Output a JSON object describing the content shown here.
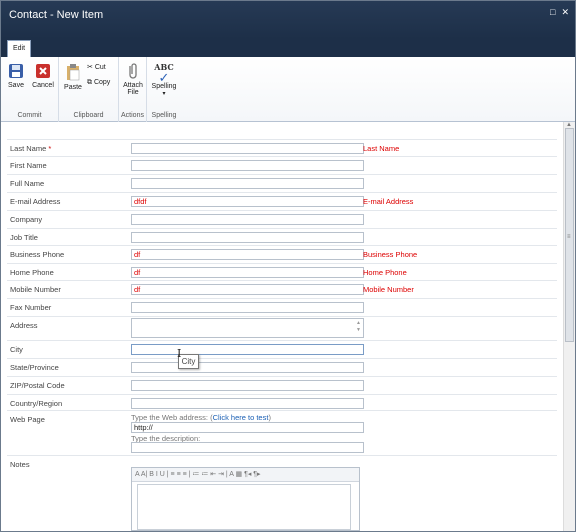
{
  "window": {
    "title": "Contact - New Item"
  },
  "ribbon": {
    "tab": "Edit",
    "groups": [
      {
        "name": "Commit",
        "buttons": [
          "Save",
          "Cancel"
        ]
      },
      {
        "name": "Clipboard",
        "buttons": [
          "Paste",
          "Cut",
          "Copy"
        ]
      },
      {
        "name": "Actions",
        "buttons": [
          "Attach\nFile"
        ]
      },
      {
        "name": "Spelling",
        "buttons": [
          "Spelling"
        ]
      }
    ],
    "save": "Save",
    "cancel": "Cancel",
    "paste": "Paste",
    "cut": "Cut",
    "copy": "Copy",
    "attach1": "Attach",
    "attach2": "File",
    "spelling": "Spelling",
    "abc": "ABC",
    "g_commit": "Commit",
    "g_clipboard": "Clipboard",
    "g_actions": "Actions",
    "g_spelling": "Spelling"
  },
  "form": {
    "fields": [
      {
        "label": "Last Name",
        "required": true,
        "value": "",
        "error": "Last Name"
      },
      {
        "label": "First Name",
        "value": ""
      },
      {
        "label": "Full Name",
        "value": ""
      },
      {
        "label": "E-mail Address",
        "value": "dfdf",
        "error": "E-mail Address"
      },
      {
        "label": "Company",
        "value": ""
      },
      {
        "label": "Job Title",
        "value": ""
      },
      {
        "label": "Business Phone",
        "value": "df",
        "error": "Business Phone"
      },
      {
        "label": "Home Phone",
        "value": "df",
        "error": "Home Phone"
      },
      {
        "label": "Mobile Number",
        "value": "df",
        "error": "Mobile Number"
      },
      {
        "label": "Fax Number",
        "value": ""
      },
      {
        "label": "Address",
        "value": ""
      },
      {
        "label": "City",
        "value": ""
      },
      {
        "label": "State/Province",
        "value": ""
      },
      {
        "label": "ZIP/Postal Code",
        "value": ""
      },
      {
        "label": "Country/Region",
        "value": ""
      },
      {
        "label": "Web Page"
      },
      {
        "label": "Notes"
      }
    ],
    "required_mark": "*",
    "web": {
      "hint": "Type the Web address: (",
      "link": "Click here to test",
      "hint_end": ")",
      "value": "http://",
      "desc_hint": "Type the description:"
    },
    "tooltip": "City"
  },
  "rte_toolbar": "A A| B I U | ≡ ≡ ≡ | ≔ ≔ ⇤ ⇥ | A ▦ ¶◂ ¶▸"
}
